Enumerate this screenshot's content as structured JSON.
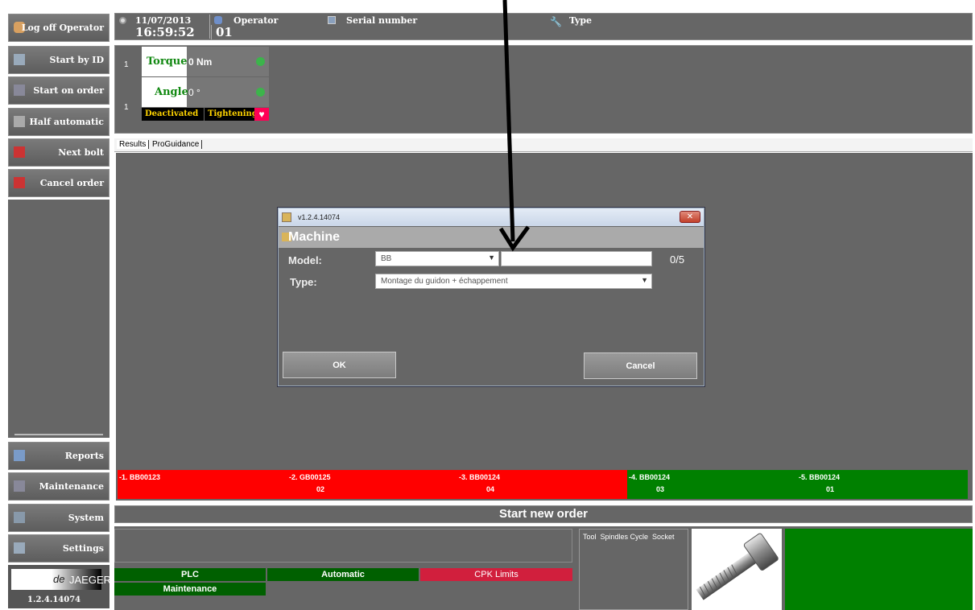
{
  "header": {
    "date": "11/07/2013",
    "time": "16:59:52",
    "operator_label": "Operator",
    "operator_value": "01",
    "serial_label": "Serial number",
    "type_label": "Type"
  },
  "sidebar": {
    "log_off": "Log off Operator",
    "start_by_id": "Start by ID",
    "start_on_order": "Start on order",
    "half_automatic": "Half automatic",
    "next_bolt": "Next bolt",
    "cancel_order": "Cancel order",
    "reports": "Reports",
    "maintenance": "Maintenance",
    "system": "System",
    "settings": "Settings",
    "version": "1.2.4.14074"
  },
  "logo": {
    "de": "de",
    "brand": "JAEGER"
  },
  "spindle": {
    "row1_num": "1",
    "row2_num": "1",
    "torque_label": "Torque",
    "torque_value": "0 Nm",
    "angle_label": "Angle",
    "angle_value": "0 °",
    "deactivated": "Deactivated",
    "tightening": "Tightening"
  },
  "tabs": {
    "results": "Results",
    "proguidance": "ProGuidance"
  },
  "dialog": {
    "title": "v1.2.4.14074",
    "heading": "Machine",
    "model_label": "Model:",
    "model_value": "BB",
    "model_count": "0/5",
    "type_label": "Type:",
    "type_value": "Montage du guidon + échappement",
    "ok": "OK",
    "cancel": "Cancel"
  },
  "results": [
    {
      "line1": "-1.  BB00123",
      "line2": "",
      "color": "#ff0000"
    },
    {
      "line1": "-2.  GB00125",
      "line2": "02",
      "color": "#ff0000"
    },
    {
      "line1": "-3.  BB00124",
      "line2": "04",
      "color": "#ff0000"
    },
    {
      "line1": "-4.  BB00124",
      "line2": "03",
      "color": "#008000"
    },
    {
      "line1": "-5.  BB00124",
      "line2": "01",
      "color": "#008000"
    }
  ],
  "status": {
    "start_new_order": "Start new order",
    "tool_header": "Tool  Spindles Cycle  Socket",
    "plc": "PLC",
    "automatic": "Automatic",
    "cpk": "CPK Limits",
    "maintenance": "Maintenance"
  },
  "colors": {
    "panel": "#666666",
    "green": "#008000",
    "red": "#ff0000",
    "cpk": "#d11f3d"
  }
}
